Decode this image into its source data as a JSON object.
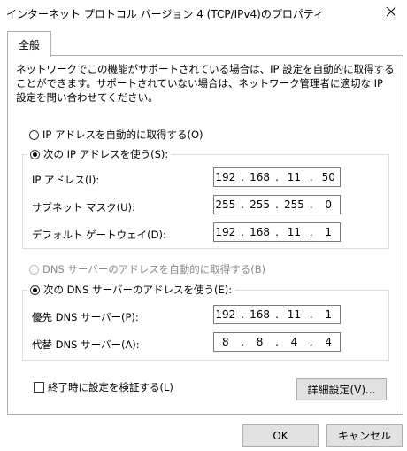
{
  "window": {
    "title": "インターネット プロトコル バージョン 4 (TCP/IPv4)のプロパティ"
  },
  "tabs": [
    {
      "label": "全般"
    }
  ],
  "description": "ネットワークでこの機能がサポートされている場合は、IP 設定を自動的に取得することができます。サポートされていない場合は、ネットワーク管理者に適切な IP 設定を問い合わせてください。",
  "ip_section": {
    "auto_label": "IP アドレスを自動的に取得する(O)",
    "manual_label": "次の IP アドレスを使う(S):",
    "selected": "manual",
    "fields": [
      {
        "label": "IP アドレス(I):",
        "octets": [
          "192",
          "168",
          "11",
          "50"
        ]
      },
      {
        "label": "サブネット マスク(U):",
        "octets": [
          "255",
          "255",
          "255",
          "0"
        ]
      },
      {
        "label": "デフォルト ゲートウェイ(D):",
        "octets": [
          "192",
          "168",
          "11",
          "1"
        ]
      }
    ]
  },
  "dns_section": {
    "auto_label": "DNS サーバーのアドレスを自動的に取得する(B)",
    "manual_label": "次の DNS サーバーのアドレスを使う(E):",
    "selected": "manual",
    "fields": [
      {
        "label": "優先 DNS サーバー(P):",
        "octets": [
          "192",
          "168",
          "11",
          "1"
        ]
      },
      {
        "label": "代替 DNS サーバー(A):",
        "octets": [
          "8",
          "8",
          "4",
          "4"
        ]
      }
    ]
  },
  "validate_checkbox": {
    "label": "終了時に設定を検証する(L)",
    "checked": false
  },
  "buttons": {
    "advanced": "詳細設定(V)...",
    "ok": "OK",
    "cancel": "キャンセル"
  },
  "icons": {
    "close": "close-icon"
  }
}
